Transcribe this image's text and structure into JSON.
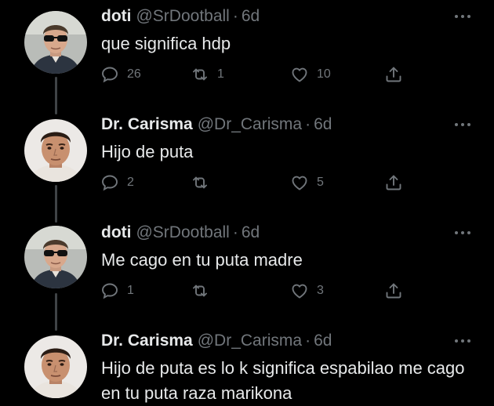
{
  "tweets": [
    {
      "name": "doti",
      "handle": "@SrDootball",
      "dot": "·",
      "time": "6d",
      "text": "que significa hdp",
      "replies": "26",
      "retweets": "1",
      "likes": "10"
    },
    {
      "name": "Dr. Carisma",
      "handle": "@Dr_Carisma",
      "dot": "·",
      "time": "6d",
      "text": "Hijo de puta",
      "replies": "2",
      "retweets": "",
      "likes": "5"
    },
    {
      "name": "doti",
      "handle": "@SrDootball",
      "dot": "·",
      "time": "6d",
      "text": "Me cago en tu puta madre",
      "replies": "1",
      "retweets": "",
      "likes": "3"
    },
    {
      "name": "Dr. Carisma",
      "handle": "@Dr_Carisma",
      "dot": "·",
      "time": "6d",
      "text": "Hijo de puta es lo k significa espabilao me cago en tu puta raza marikona"
    }
  ],
  "icons": {
    "reply": "reply-icon",
    "retweet": "retweet-icon",
    "like": "heart-icon",
    "share": "share-icon",
    "more": "more-icon"
  },
  "colors": {
    "background": "#000000",
    "text": "#e7e9ea",
    "muted": "#71767b",
    "thread_line": "#3f4346"
  }
}
